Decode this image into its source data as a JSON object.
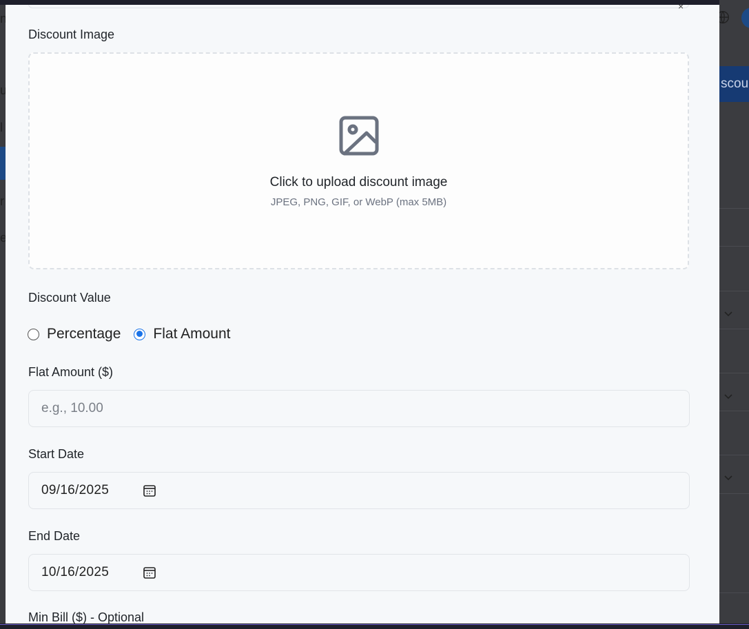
{
  "background": {
    "button_text": "scoun",
    "left_fragments": [
      "nl",
      "u",
      "l",
      "r",
      "e",
      "e"
    ]
  },
  "modal": {
    "close_symbol": "×",
    "upload": {
      "label": "Discount Image",
      "title": "Click to upload discount image",
      "subtitle": "JPEG, PNG, GIF, or WebP (max 5MB)",
      "icon": "image-icon"
    },
    "discount_value": {
      "label": "Discount Value",
      "options": [
        {
          "label": "Percentage",
          "selected": false
        },
        {
          "label": "Flat Amount",
          "selected": true
        }
      ]
    },
    "flat_amount": {
      "label": "Flat Amount ($)",
      "placeholder": "e.g., 10.00",
      "value": ""
    },
    "start_date": {
      "label": "Start Date",
      "value": "09/16/2025",
      "icon": "calendar-icon"
    },
    "end_date": {
      "label": "End Date",
      "value": "10/16/2025",
      "icon": "calendar-icon"
    },
    "min_bill": {
      "label": "Min Bill ($) - Optional"
    }
  },
  "colors": {
    "accent": "#1a73e8",
    "modal_bg": "#f6f8fa",
    "overlay_bg": "#3a3b3f",
    "brand_button": "#163a73"
  }
}
